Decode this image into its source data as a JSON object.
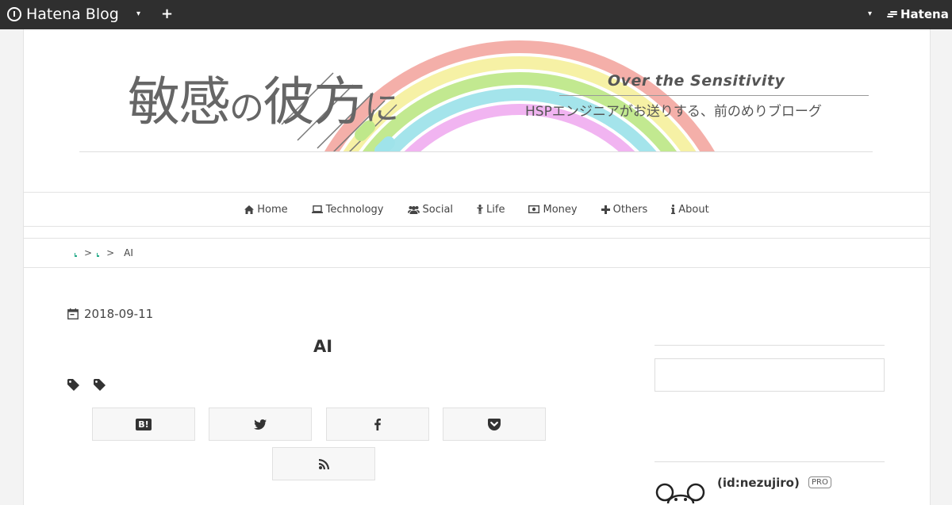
{
  "topbar": {
    "brand": "Hatena Blog",
    "plus_label": "+",
    "right_brand": "Hatena",
    "caret": "▾"
  },
  "blog": {
    "title_parts": [
      "敏感",
      "の",
      "彼方",
      "に"
    ],
    "subtitle": "Over the Sensitivity",
    "description": "HSPエンジニアがお送りする、前のめりブローグ"
  },
  "nav": {
    "items": [
      {
        "label": "Home",
        "icon": "home-icon"
      },
      {
        "label": "Technology",
        "icon": "laptop-icon"
      },
      {
        "label": "Social",
        "icon": "users-icon"
      },
      {
        "label": "Life",
        "icon": "person-icon"
      },
      {
        "label": "Money",
        "icon": "money-icon"
      },
      {
        "label": "Others",
        "icon": "plus-icon"
      },
      {
        "label": "About",
        "icon": "info-icon"
      }
    ]
  },
  "breadcrumb": {
    "separators": [
      ">",
      ">"
    ],
    "current": "AI"
  },
  "article": {
    "date": "2018-09-11",
    "title": "AI"
  },
  "share": {
    "buttons": [
      {
        "name": "hatena-bookmark",
        "label": "B!"
      },
      {
        "name": "twitter",
        "label": ""
      },
      {
        "name": "facebook",
        "label": "f"
      },
      {
        "name": "pocket",
        "label": ""
      },
      {
        "name": "feed",
        "label": ""
      }
    ]
  },
  "sidebar": {
    "profile_id": "(id:nezujiro)",
    "pro_label": "PRO"
  },
  "colors": {
    "topbar": "#2f2f2f",
    "background": "#f3f3f3",
    "rainbow": [
      "#f3a6a0",
      "#f5f0a0",
      "#bfe88a",
      "#9fe3ea",
      "#f0b0f0"
    ]
  }
}
